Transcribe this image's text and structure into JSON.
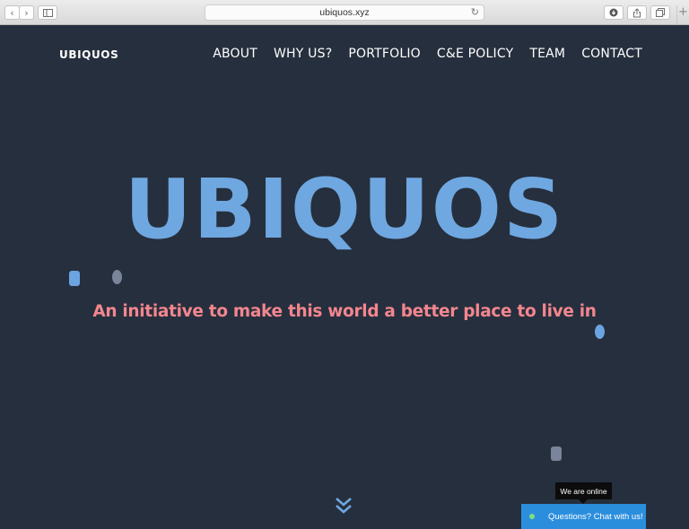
{
  "browser": {
    "url": "ubiquos.xyz",
    "icons": {
      "back": "chevron-left-icon",
      "forward": "chevron-right-icon",
      "sidebar": "sidebar-icon",
      "reload": "reload-icon",
      "download": "download-icon",
      "share": "share-icon",
      "tabs": "tabs-icon",
      "new_tab": "plus-icon"
    }
  },
  "header": {
    "logo": "UBIQUOS",
    "nav": [
      "ABOUT",
      "WHY US?",
      "PORTFOLIO",
      "C&E POLICY",
      "TEAM",
      "CONTACT"
    ]
  },
  "hero": {
    "title": "UBIQUOS",
    "subtitle": "An initiative to make this world a better place to live in",
    "scroll_icon": "double-chevron-down-icon"
  },
  "chat": {
    "status_tooltip": "We are online",
    "label": "Questions? Chat with us!"
  },
  "colors": {
    "background": "#262f3d",
    "title": "#6fa7e0",
    "subtitle": "#f3868f",
    "chat_bar": "#2b8edd",
    "online": "#7ee081"
  }
}
